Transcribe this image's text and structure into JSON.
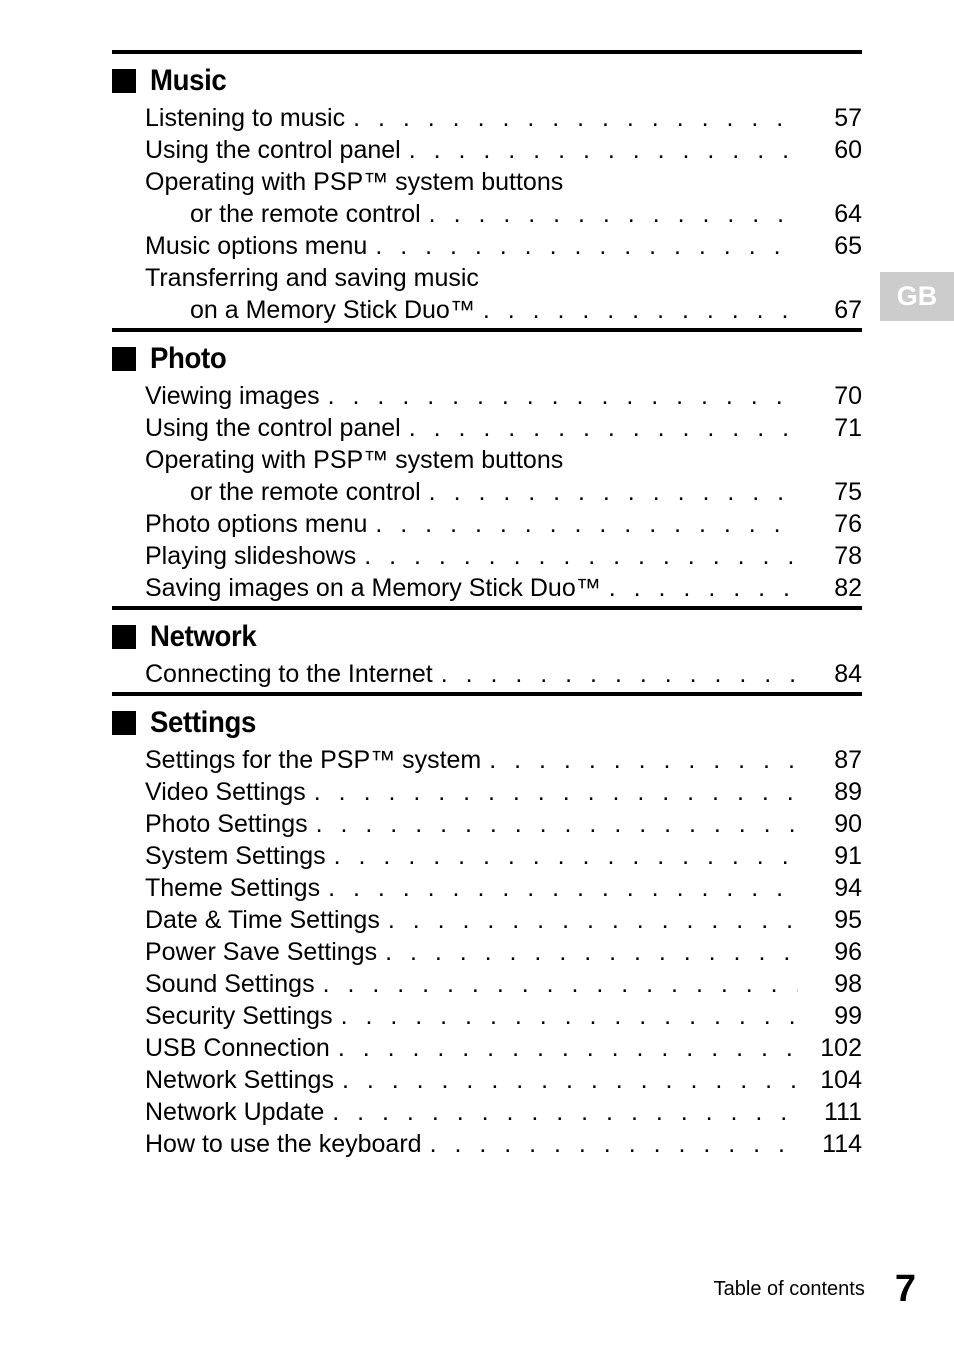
{
  "document": {
    "footer_label": "Table of contents",
    "footer_page": "7",
    "language_badge": "GB",
    "badge_color": "#cccccc"
  },
  "sections": [
    {
      "title": "Music",
      "bullet": "filled-square-icon",
      "entries": [
        {
          "label": "Listening to music",
          "page": "57",
          "continuation": false,
          "leader": true
        },
        {
          "label": "Using the control panel",
          "page": "60",
          "continuation": false,
          "leader": true
        },
        {
          "label": "Operating with PSP™ system buttons",
          "page": "",
          "continuation": false,
          "leader": false
        },
        {
          "label": "or the remote control",
          "page": "64",
          "continuation": true,
          "leader": true
        },
        {
          "label": "Music options menu",
          "page": "65",
          "continuation": false,
          "leader": true
        },
        {
          "label": "Transferring and saving music",
          "page": "",
          "continuation": false,
          "leader": false
        },
        {
          "label": "on a Memory Stick Duo™",
          "page": "67",
          "continuation": true,
          "leader": true
        }
      ]
    },
    {
      "title": "Photo",
      "bullet": "filled-square-icon",
      "entries": [
        {
          "label": "Viewing images",
          "page": "70",
          "continuation": false,
          "leader": true
        },
        {
          "label": "Using the control panel",
          "page": "71",
          "continuation": false,
          "leader": true
        },
        {
          "label": "Operating with PSP™ system buttons",
          "page": "",
          "continuation": false,
          "leader": false
        },
        {
          "label": "or the remote control",
          "page": "75",
          "continuation": true,
          "leader": true
        },
        {
          "label": "Photo options menu",
          "page": "76",
          "continuation": false,
          "leader": true
        },
        {
          "label": "Playing slideshows",
          "page": "78",
          "continuation": false,
          "leader": true
        },
        {
          "label": "Saving images on a Memory Stick Duo™",
          "page": "82",
          "continuation": false,
          "leader": true
        }
      ]
    },
    {
      "title": "Network",
      "bullet": "filled-square-icon",
      "entries": [
        {
          "label": "Connecting to the Internet",
          "page": "84",
          "continuation": false,
          "leader": true
        }
      ]
    },
    {
      "title": "Settings",
      "bullet": "filled-square-icon",
      "entries": [
        {
          "label": "Settings for the PSP™ system",
          "page": "87",
          "continuation": false,
          "leader": true
        },
        {
          "label": "Video Settings",
          "page": "89",
          "continuation": false,
          "leader": true
        },
        {
          "label": "Photo Settings",
          "page": "90",
          "continuation": false,
          "leader": true
        },
        {
          "label": "System Settings",
          "page": "91",
          "continuation": false,
          "leader": true
        },
        {
          "label": "Theme Settings",
          "page": "94",
          "continuation": false,
          "leader": true
        },
        {
          "label": "Date & Time Settings",
          "page": "95",
          "continuation": false,
          "leader": true
        },
        {
          "label": "Power Save Settings",
          "page": "96",
          "continuation": false,
          "leader": true
        },
        {
          "label": "Sound Settings",
          "page": "98",
          "continuation": false,
          "leader": true
        },
        {
          "label": "Security Settings",
          "page": "99",
          "continuation": false,
          "leader": true
        },
        {
          "label": "USB Connection",
          "page": "102",
          "continuation": false,
          "leader": true
        },
        {
          "label": "Network Settings",
          "page": "104",
          "continuation": false,
          "leader": true
        },
        {
          "label": "Network Update",
          "page": "111",
          "continuation": false,
          "leader": true
        },
        {
          "label": "How to use the keyboard",
          "page": "114",
          "continuation": false,
          "leader": true
        }
      ]
    }
  ],
  "leader_dots": ". . . . . . . . . . . . . . . . . . . . . . . . . . . . . . . . . . . . . . . . . . . . . . . . . . . ."
}
